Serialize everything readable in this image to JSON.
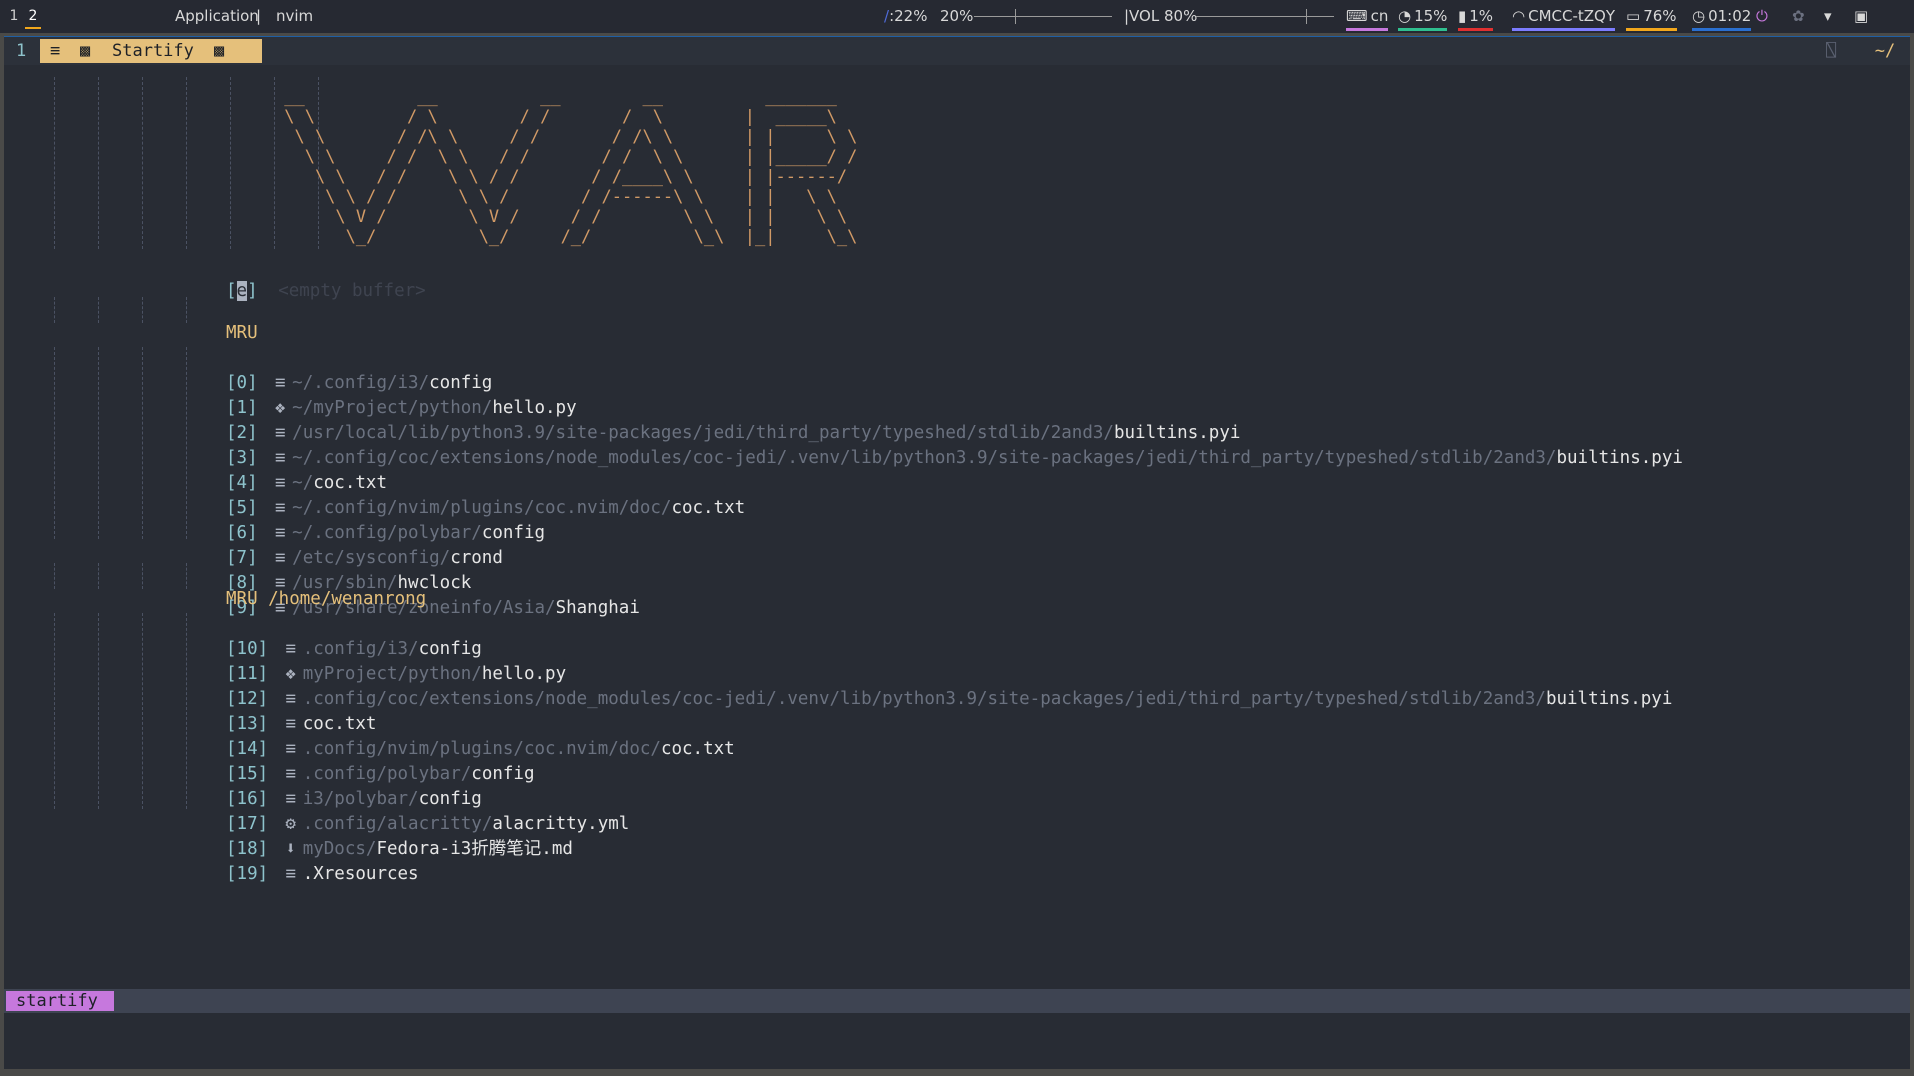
{
  "topbar": {
    "workspaces": [
      "1",
      "2"
    ],
    "app_label": "Application",
    "separator": "|",
    "window_title": "nvim",
    "brightness_text": ":22%",
    "backlight_text": "20%",
    "backlight_level": 0.3,
    "volume_text": "|VOL 80%",
    "volume_level": 0.8,
    "keyboard_text": "cn",
    "cpu_text": "15%",
    "mem_text": "1%",
    "wifi_text": "CMCC-tZQY",
    "battery_text": "76%",
    "clock_text": "01:02",
    "colors": {
      "keyboard": "#c678dd",
      "cpu": "#2fbf8f",
      "mem": "#e03030",
      "wifi": "#7c7cff",
      "battery": "#f2a71c",
      "clock": "#2a6fd0"
    }
  },
  "tabline": {
    "tab_number": "1",
    "tab_title": "Startify",
    "cwd": "~/"
  },
  "startify": {
    "empty_index": "[e]",
    "empty_label": "<empty buffer>",
    "section1_header": "MRU",
    "section1": [
      {
        "idx": "[0]",
        "icon": "≡",
        "dir": "~/.config/i3/",
        "name": "config"
      },
      {
        "idx": "[1]",
        "icon": "❖",
        "dir": "~/myProject/python/",
        "name": "hello.py"
      },
      {
        "idx": "[2]",
        "icon": "≡",
        "dir": "/usr/local/lib/python3.9/site-packages/jedi/third_party/typeshed/stdlib/2and3/",
        "name": "builtins.pyi"
      },
      {
        "idx": "[3]",
        "icon": "≡",
        "dir": "~/.config/coc/extensions/node_modules/coc-jedi/.venv/lib/python3.9/site-packages/jedi/third_party/typeshed/stdlib/2and3/",
        "name": "builtins.pyi"
      },
      {
        "idx": "[4]",
        "icon": "≡",
        "dir": "~/",
        "name": "coc.txt"
      },
      {
        "idx": "[5]",
        "icon": "≡",
        "dir": "~/.config/nvim/plugins/coc.nvim/doc/",
        "name": "coc.txt"
      },
      {
        "idx": "[6]",
        "icon": "≡",
        "dir": "~/.config/polybar/",
        "name": "config"
      },
      {
        "idx": "[7]",
        "icon": "≡",
        "dir": "/etc/sysconfig/",
        "name": "crond"
      },
      {
        "idx": "[8]",
        "icon": "≡",
        "dir": "/usr/sbin/",
        "name": "hwclock"
      },
      {
        "idx": "[9]",
        "icon": "≡",
        "dir": "/usr/share/zoneinfo/Asia/",
        "name": "Shanghai"
      }
    ],
    "section2_header": "MRU /home/wenanrong",
    "section2": [
      {
        "idx": "[10]",
        "icon": "≡",
        "dir": ".config/i3/",
        "name": "config"
      },
      {
        "idx": "[11]",
        "icon": "❖",
        "dir": "myProject/python/",
        "name": "hello.py"
      },
      {
        "idx": "[12]",
        "icon": "≡",
        "dir": ".config/coc/extensions/node_modules/coc-jedi/.venv/lib/python3.9/site-packages/jedi/third_party/typeshed/stdlib/2and3/",
        "name": "builtins.pyi"
      },
      {
        "idx": "[13]",
        "icon": "≡",
        "dir": "",
        "name": "coc.txt"
      },
      {
        "idx": "[14]",
        "icon": "≡",
        "dir": ".config/nvim/plugins/coc.nvim/doc/",
        "name": "coc.txt"
      },
      {
        "idx": "[15]",
        "icon": "≡",
        "dir": ".config/polybar/",
        "name": "config"
      },
      {
        "idx": "[16]",
        "icon": "≡",
        "dir": "i3/polybar/",
        "name": "config"
      },
      {
        "idx": "[17]",
        "icon": "⚙",
        "dir": ".config/alacritty/",
        "name": "alacritty.yml"
      },
      {
        "idx": "[18]",
        "icon": "⬇",
        "dir": "myDocs/",
        "name": "Fedora-i3折腾笔记.md"
      },
      {
        "idx": "[19]",
        "icon": "≡",
        "dir": "",
        "name": ".Xresources"
      }
    ]
  },
  "statusline": {
    "mode": "startify"
  }
}
